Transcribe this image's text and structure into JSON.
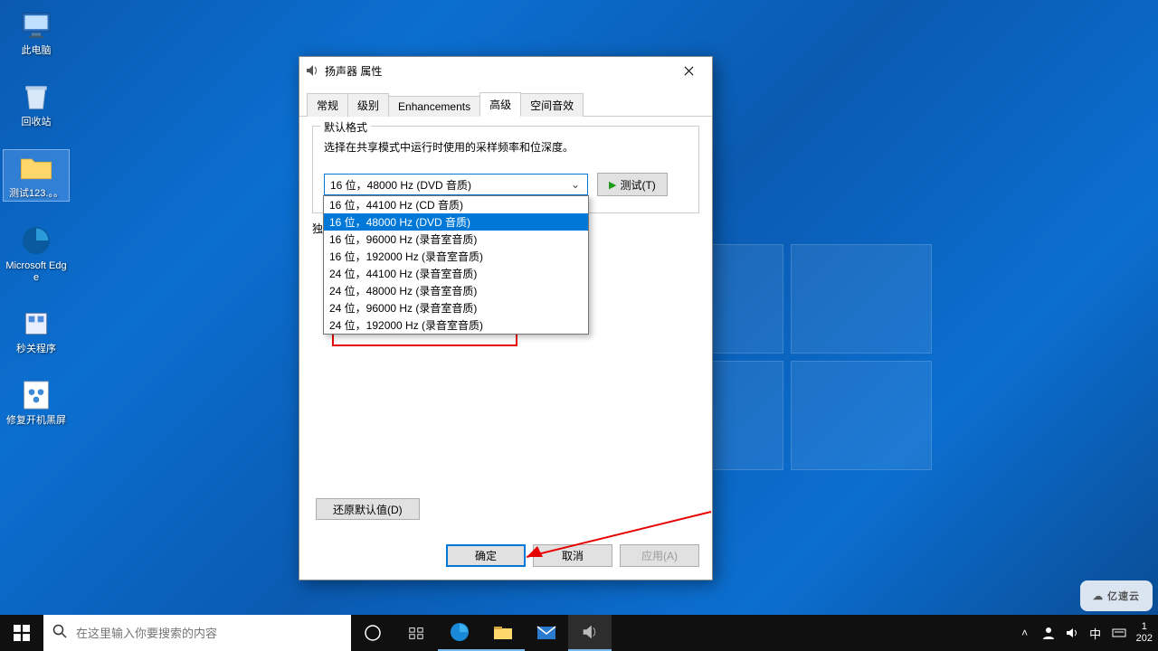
{
  "desktop_icons": [
    {
      "name": "此电脑",
      "key": "this-pc"
    },
    {
      "name": "回收站",
      "key": "recycle-bin"
    },
    {
      "name": "测试123.。。",
      "key": "test-folder"
    },
    {
      "name": "Microsoft Edge",
      "key": "edge"
    },
    {
      "name": "秒关程序",
      "key": "close-app"
    },
    {
      "name": "修复开机黑屏",
      "key": "fix-boot"
    }
  ],
  "dialog": {
    "title": "扬声器 属性",
    "tabs": [
      "常规",
      "级别",
      "Enhancements",
      "高级",
      "空间音效"
    ],
    "active_tab": "高级",
    "group_label": "默认格式",
    "desc": "选择在共享模式中运行时使用的采样频率和位深度。",
    "combo_selected": "16 位，48000 Hz (DVD 音质)",
    "test_label": "测试(T)",
    "peek_label": "独",
    "options": [
      "16 位，44100 Hz (CD 音质)",
      "16 位，48000 Hz (DVD 音质)",
      "16 位，96000 Hz (录音室音质)",
      "16 位，192000 Hz (录音室音质)",
      "24 位，44100 Hz (录音室音质)",
      "24 位，48000 Hz (录音室音质)",
      "24 位，96000 Hz (录音室音质)",
      "24 位，192000 Hz (录音室音质)"
    ],
    "selected_index": 1,
    "restore_label": "还原默认值(D)",
    "ok_label": "确定",
    "cancel_label": "取消",
    "apply_label": "应用(A)"
  },
  "taskbar": {
    "search_placeholder": "在这里输入你要搜索的内容",
    "ime": "中",
    "time": "1",
    "date": "202"
  },
  "watermark": "亿速云"
}
